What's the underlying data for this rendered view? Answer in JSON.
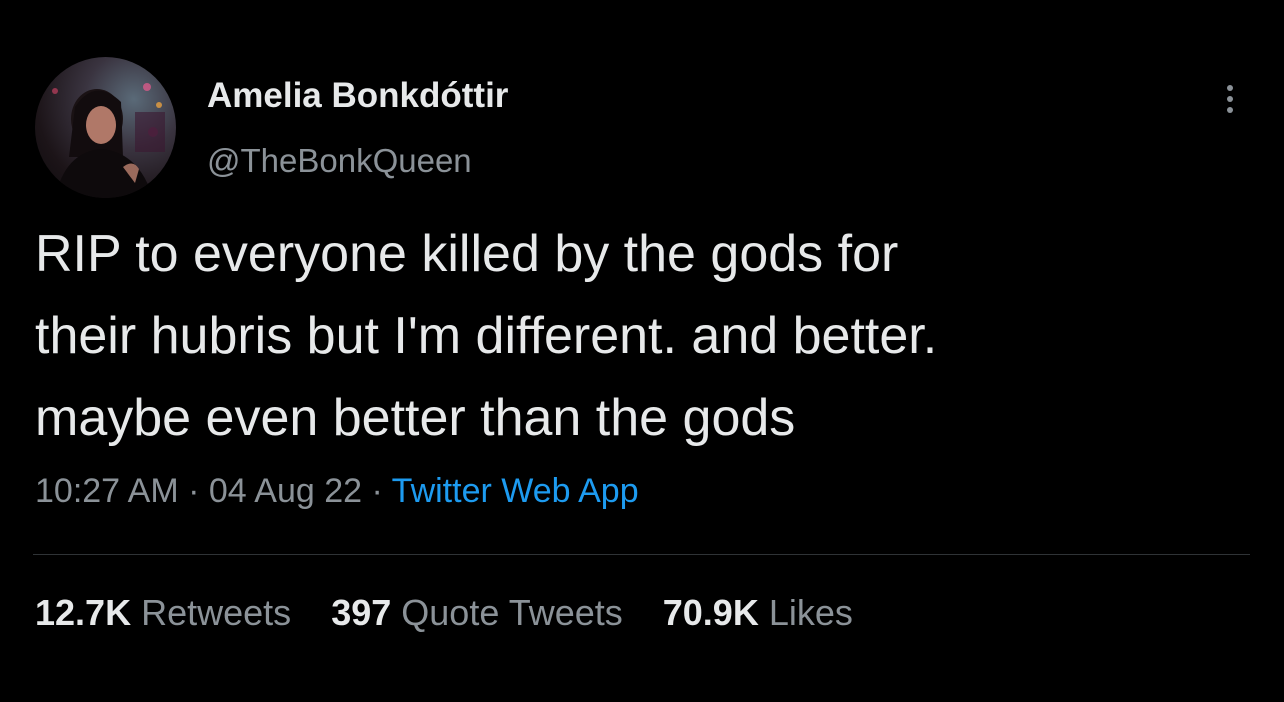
{
  "author": {
    "name": "Amelia Bonkdóttir",
    "handle": "@TheBonkQueen"
  },
  "tweet": {
    "lines": [
      "RIP to everyone killed by the gods for",
      "their hubris but I'm different. and better.",
      "maybe even better than the gods"
    ],
    "time": "10:27 AM",
    "date": "04 Aug 22",
    "separator": "·",
    "source": "Twitter Web App"
  },
  "stats": {
    "retweets_count": "12.7K",
    "retweets_label": "Retweets",
    "quotes_count": "397",
    "quotes_label": "Quote Tweets",
    "likes_count": "70.9K",
    "likes_label": "Likes"
  },
  "colors": {
    "background": "#000000",
    "text": "#e7e9ea",
    "secondary": "#8b9298",
    "link": "#1d9bf0",
    "divider": "#2f3336"
  },
  "icons": {
    "more": "more-vertical-icon"
  }
}
